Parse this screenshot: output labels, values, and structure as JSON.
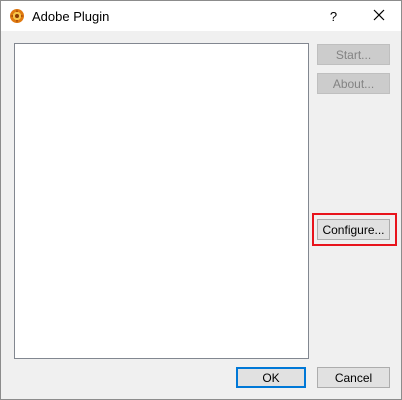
{
  "window": {
    "title": "Adobe Plugin",
    "help_label": "?",
    "icon": "adobe-plugin-app-icon",
    "close_icon": "close-icon"
  },
  "buttons": {
    "start": "Start...",
    "about": "About...",
    "configure": "Configure...",
    "ok": "OK",
    "cancel": "Cancel"
  },
  "colors": {
    "highlight": "#e8141c",
    "default_button_border": "#0078d7"
  }
}
